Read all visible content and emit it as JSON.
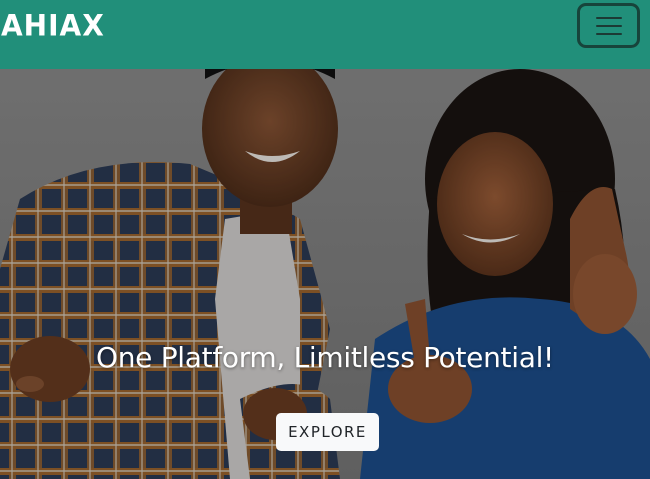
{
  "navbar": {
    "brand": "AHIAX",
    "menu_icon": "hamburger-menu-icon",
    "background_color": "#218f7a"
  },
  "hero": {
    "title": "One Platform, Limitless Potential!",
    "button_label": "EXPLORE",
    "image_description_icon": "hero-photo-two-people-pointing"
  }
}
